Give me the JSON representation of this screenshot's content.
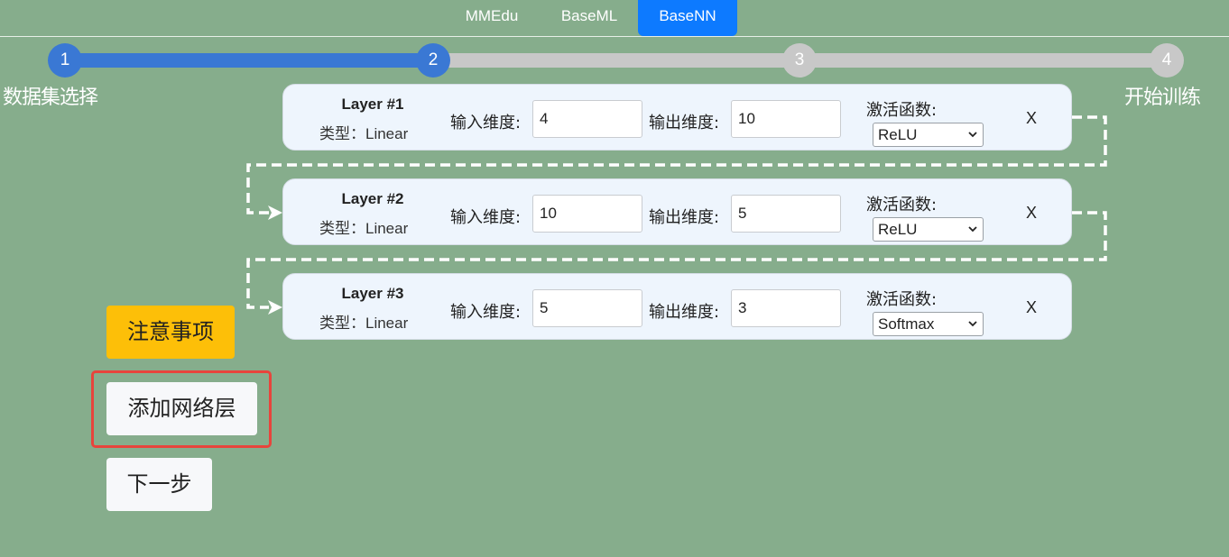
{
  "nav": {
    "tabs": [
      {
        "label": "MMEdu",
        "active": false
      },
      {
        "label": "BaseML",
        "active": false
      },
      {
        "label": "BaseNN",
        "active": true
      }
    ]
  },
  "steps": {
    "current": 2,
    "items": [
      {
        "number": "1",
        "label": "数据集选择",
        "state": "done"
      },
      {
        "number": "2",
        "label": "",
        "state": "current"
      },
      {
        "number": "3",
        "label": "",
        "state": "todo"
      },
      {
        "number": "4",
        "label": "开始训练",
        "state": "todo"
      }
    ]
  },
  "layer_common": {
    "type_prefix": "类型：",
    "input_label": "输入维度:",
    "output_label": "输出维度:",
    "activation_label": "激活函数:",
    "remove_label": "X"
  },
  "layers": [
    {
      "title": "Layer #1",
      "type": "Linear",
      "input_dim": "4",
      "output_dim": "10",
      "activation": "ReLU"
    },
    {
      "title": "Layer #2",
      "type": "Linear",
      "input_dim": "10",
      "output_dim": "5",
      "activation": "ReLU"
    },
    {
      "title": "Layer #3",
      "type": "Linear",
      "input_dim": "5",
      "output_dim": "3",
      "activation": "Softmax"
    }
  ],
  "buttons": {
    "notice": "注意事项",
    "add_layer": "添加网络层",
    "next_step": "下一步"
  },
  "colors": {
    "background": "#86ad8c",
    "tab_active": "#0d7aff",
    "step_done": "#3a78d4",
    "step_todo": "#c8c8c8",
    "warning": "#fdbf08",
    "highlight": "#e8443c",
    "card_bg": "#eef5fd"
  },
  "icons": {
    "select": "chevron-down-icon",
    "connector": "arrow-right-icon"
  }
}
